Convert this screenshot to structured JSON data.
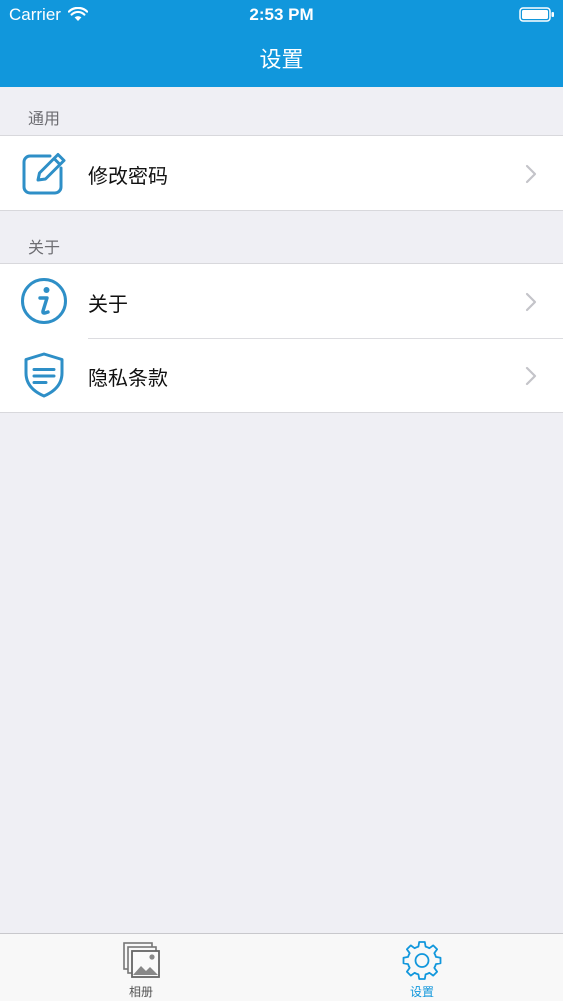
{
  "status_bar": {
    "carrier": "Carrier",
    "time": "2:53 PM"
  },
  "nav": {
    "title": "设置"
  },
  "sections": [
    {
      "header": "通用",
      "items": [
        {
          "label": "修改密码",
          "icon": "edit-icon"
        }
      ]
    },
    {
      "header": "关于",
      "items": [
        {
          "label": "关于",
          "icon": "info-icon"
        },
        {
          "label": "隐私条款",
          "icon": "shield-icon"
        }
      ]
    }
  ],
  "tab_bar": {
    "tabs": [
      {
        "label": "相册",
        "icon": "photo-album-icon",
        "selected": false
      },
      {
        "label": "设置",
        "icon": "gear-icon",
        "selected": true
      }
    ]
  },
  "colors": {
    "accent": "#1197dc",
    "icon_blue": "#2e8fc7",
    "background": "#efeff4",
    "tab_inactive": "#555555"
  }
}
